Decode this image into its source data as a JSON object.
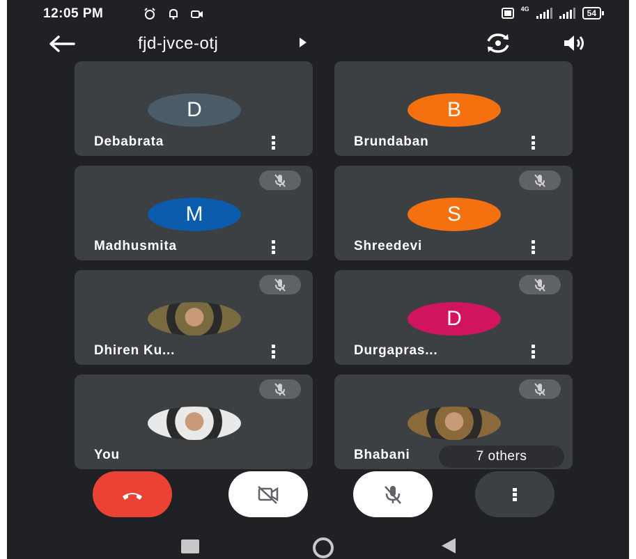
{
  "status_bar": {
    "time": "12:05 PM",
    "network_label": "4G",
    "battery": "54"
  },
  "header": {
    "meeting_code": "fjd-jvce-otj"
  },
  "participants": [
    {
      "name": "Debabrata",
      "initial": "D",
      "avatar_color": "#4a5c68",
      "muted": false,
      "photo": false
    },
    {
      "name": "Brundaban",
      "initial": "B",
      "avatar_color": "#f5700f",
      "muted": false,
      "photo": false
    },
    {
      "name": "Madhusmita",
      "initial": "M",
      "avatar_color": "#0b5cad",
      "muted": true,
      "photo": false
    },
    {
      "name": "Shreedevi",
      "initial": "S",
      "avatar_color": "#f5700f",
      "muted": true,
      "photo": false
    },
    {
      "name": "Dhiren Ku...",
      "initial": "",
      "avatar_color": "#7a6a40",
      "muted": true,
      "photo": true
    },
    {
      "name": "Durgapras...",
      "initial": "D",
      "avatar_color": "#d0145e",
      "muted": true,
      "photo": false
    },
    {
      "name": "You",
      "initial": "",
      "avatar_color": "#e9e9e9",
      "muted": true,
      "photo": true
    },
    {
      "name": "Bhabani",
      "initial": "",
      "avatar_color": "#8a6a3a",
      "muted": true,
      "photo": true
    }
  ],
  "others_chip": "7 others",
  "controls": {
    "end_call_color": "#ea4335",
    "camera_off": true,
    "mic_off": true
  },
  "icons": {
    "back": "arrow-left-icon",
    "switch_camera": "switch-camera-icon",
    "speaker": "speaker-icon",
    "mic_off": "mic-off-icon",
    "more": "more-vert-icon",
    "end_call": "call-end-icon",
    "camera_off": "camera-off-icon"
  }
}
